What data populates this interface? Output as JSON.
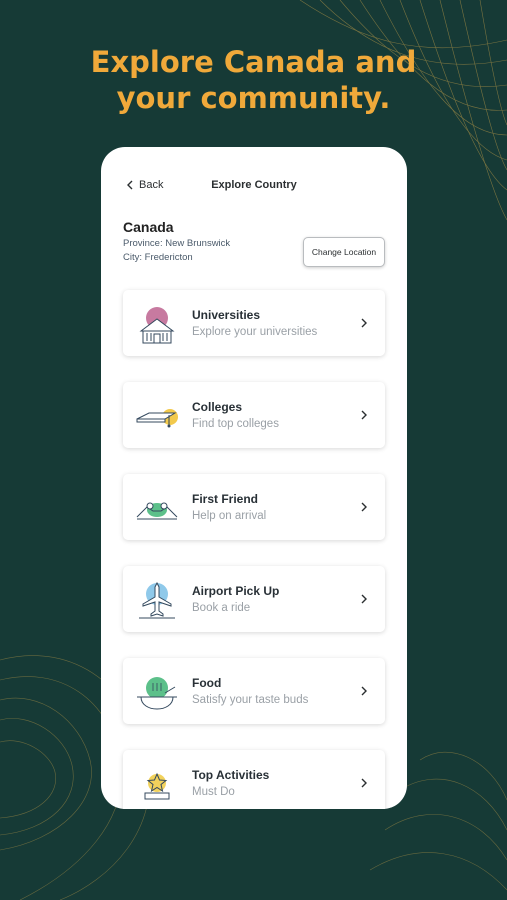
{
  "headline": {
    "line1": "Explore Canada and",
    "line2": "your community."
  },
  "nav": {
    "back_label": "Back",
    "title": "Explore Country"
  },
  "location": {
    "country": "Canada",
    "province": "Province: New Brunswick",
    "city": "City: Fredericton",
    "change_label": "Change Location"
  },
  "menu": [
    {
      "title": "Universities",
      "subtitle": "Explore your universities",
      "icon": "university-icon"
    },
    {
      "title": "Colleges",
      "subtitle": "Find top colleges",
      "icon": "college-icon"
    },
    {
      "title": "First Friend",
      "subtitle": "Help on arrival",
      "icon": "first-friend-icon"
    },
    {
      "title": "Airport Pick Up",
      "subtitle": "Book a ride",
      "icon": "airplane-icon"
    },
    {
      "title": "Food",
      "subtitle": "Satisfy your taste buds",
      "icon": "food-bowl-icon"
    },
    {
      "title": "Top Activities",
      "subtitle": "Must Do",
      "icon": "star-activity-icon"
    }
  ],
  "colors": {
    "background": "#163a36",
    "accent": "#f0a93a",
    "university": "#c77aa0",
    "college": "#f2c94c",
    "friend": "#5cc08a",
    "airport": "#8fc9ea",
    "food": "#5cc08a",
    "activities": "#f2d25c"
  }
}
